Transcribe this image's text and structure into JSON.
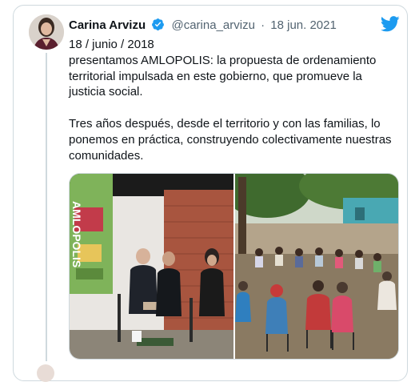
{
  "tweet": {
    "author_name": "Carina Arvizu",
    "handle": "@carina_arvizu",
    "separator": "·",
    "timestamp": "18 jun. 2021",
    "lines": [
      "18 / junio / 2018",
      "presentamos AMLOPOLIS: la propuesta de ordenamiento territorial impulsada en este gobierno, que promueve la justicia social.",
      "Tres años después, desde el territorio y con las familias, lo ponemos en práctica, construyendo colectivamente nuestras comunidades."
    ]
  },
  "media": {
    "left_photo_sign": "AMLOPOLIS"
  },
  "icons": {
    "verified": "verified-badge-icon",
    "brand": "twitter-bird-icon"
  },
  "colors": {
    "brand_blue": "#1d9bf0",
    "text": "#0f1419",
    "muted": "#536471",
    "border": "#cfd9de"
  }
}
